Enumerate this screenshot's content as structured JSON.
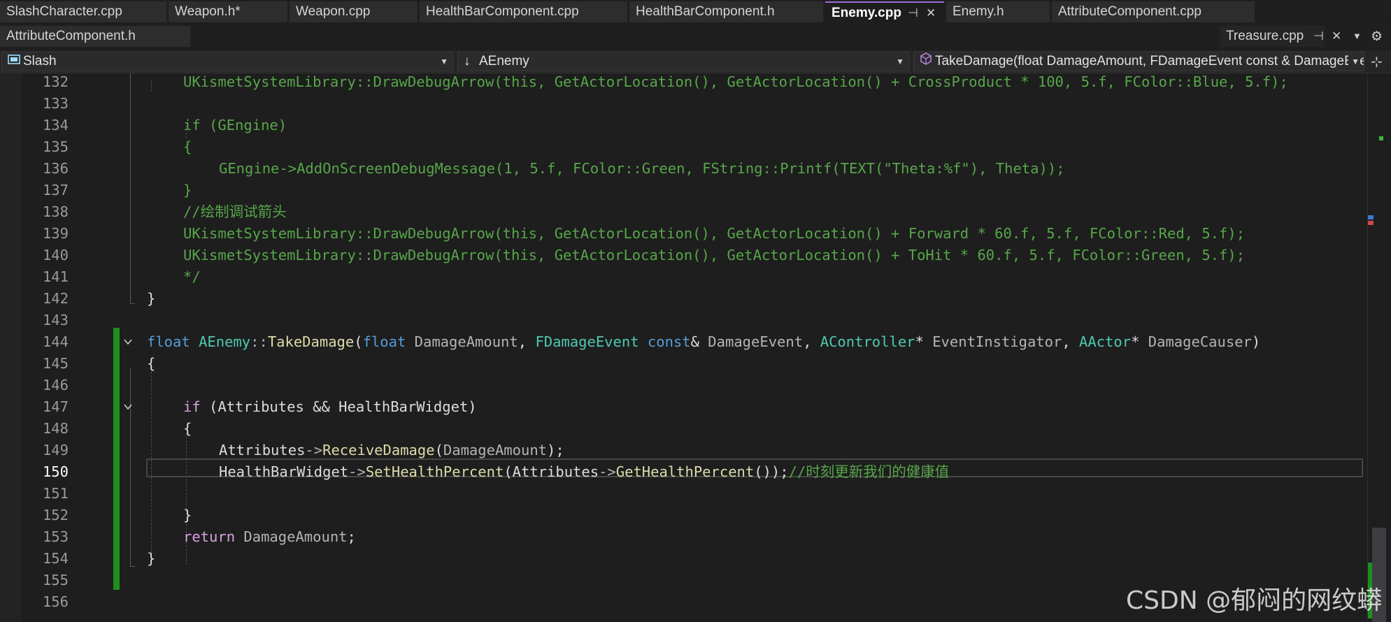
{
  "tabs_row1": [
    {
      "label": "SlashCharacter.cpp",
      "active": false
    },
    {
      "label": "Weapon.h*",
      "active": false
    },
    {
      "label": "Weapon.cpp",
      "active": false
    },
    {
      "label": "HealthBarComponent.cpp",
      "active": false
    },
    {
      "label": "HealthBarComponent.h",
      "active": false
    },
    {
      "label": "Enemy.cpp",
      "active": true
    },
    {
      "label": "Enemy.h",
      "active": false
    },
    {
      "label": "AttributeComponent.cpp",
      "active": false
    }
  ],
  "tabs_row2": [
    {
      "label": "AttributeComponent.h"
    },
    {
      "label": "Treasure.cpp"
    }
  ],
  "navbar": {
    "project": "Slash",
    "scope": "AEnemy",
    "member": "TakeDamage(float DamageAmount, FDamageEvent const & DamageEvent, AController * EventInstigator, AActor * DamageCauser)"
  },
  "editor": {
    "current_line": 150,
    "lines": [
      {
        "n": "132",
        "code": "UKismetSystemLibrary::DrawDebugArrow(this, GetActorLocation(), GetActorLocation() + CrossProduct * 100, 5.f, FColor::Blue, 5.f);"
      },
      {
        "n": "133",
        "code": ""
      },
      {
        "n": "134",
        "code": "if (GEngine)"
      },
      {
        "n": "135",
        "code": "{"
      },
      {
        "n": "136",
        "code": "GEngine->AddOnScreenDebugMessage(1, 5.f, FColor::Green, FString::Printf(TEXT(\"Theta:%f\"), Theta));"
      },
      {
        "n": "137",
        "code": "}"
      },
      {
        "n": "138",
        "code": "//绘制调试箭头"
      },
      {
        "n": "139",
        "code": "UKismetSystemLibrary::DrawDebugArrow(this, GetActorLocation(), GetActorLocation() + Forward * 60.f, 5.f, FColor::Red, 5.f);"
      },
      {
        "n": "140",
        "code": "UKismetSystemLibrary::DrawDebugArrow(this, GetActorLocation(), GetActorLocation() + ToHit * 60.f, 5.f, FColor::Green, 5.f);"
      },
      {
        "n": "141",
        "code": "*/"
      },
      {
        "n": "142",
        "code": "}"
      },
      {
        "n": "143",
        "code": ""
      },
      {
        "n": "144",
        "code": "float AEnemy::TakeDamage(float DamageAmount, FDamageEvent const& DamageEvent, AController* EventInstigator, AActor* DamageCauser)"
      },
      {
        "n": "145",
        "code": "{"
      },
      {
        "n": "146",
        "code": ""
      },
      {
        "n": "147",
        "code": "if (Attributes && HealthBarWidget)"
      },
      {
        "n": "148",
        "code": "{"
      },
      {
        "n": "149",
        "code": "Attributes->ReceiveDamage(DamageAmount);"
      },
      {
        "n": "150",
        "code": "HealthBarWidget->SetHealthPercent(Attributes->GetHealthPercent());//时刻更新我们的健康值"
      },
      {
        "n": "151",
        "code": ""
      },
      {
        "n": "152",
        "code": "}"
      },
      {
        "n": "153",
        "code": "return DamageAmount;"
      },
      {
        "n": "154",
        "code": "}"
      },
      {
        "n": "155",
        "code": ""
      },
      {
        "n": "156",
        "code": ""
      }
    ]
  },
  "watermark": "CSDN @郁闷的网纹蟒",
  "icons": [
    "pin-icon",
    "close-icon",
    "dropdown-icon",
    "gear-icon",
    "class-icon",
    "method-icon",
    "split-icon",
    "fold-icon"
  ],
  "colors": {
    "keyword": "#569cd6",
    "type": "#4ec9b0",
    "function": "#dcdcaa",
    "comment": "#57a64a",
    "string": "#d69d85",
    "changed_bar": "#1d8f1d"
  }
}
